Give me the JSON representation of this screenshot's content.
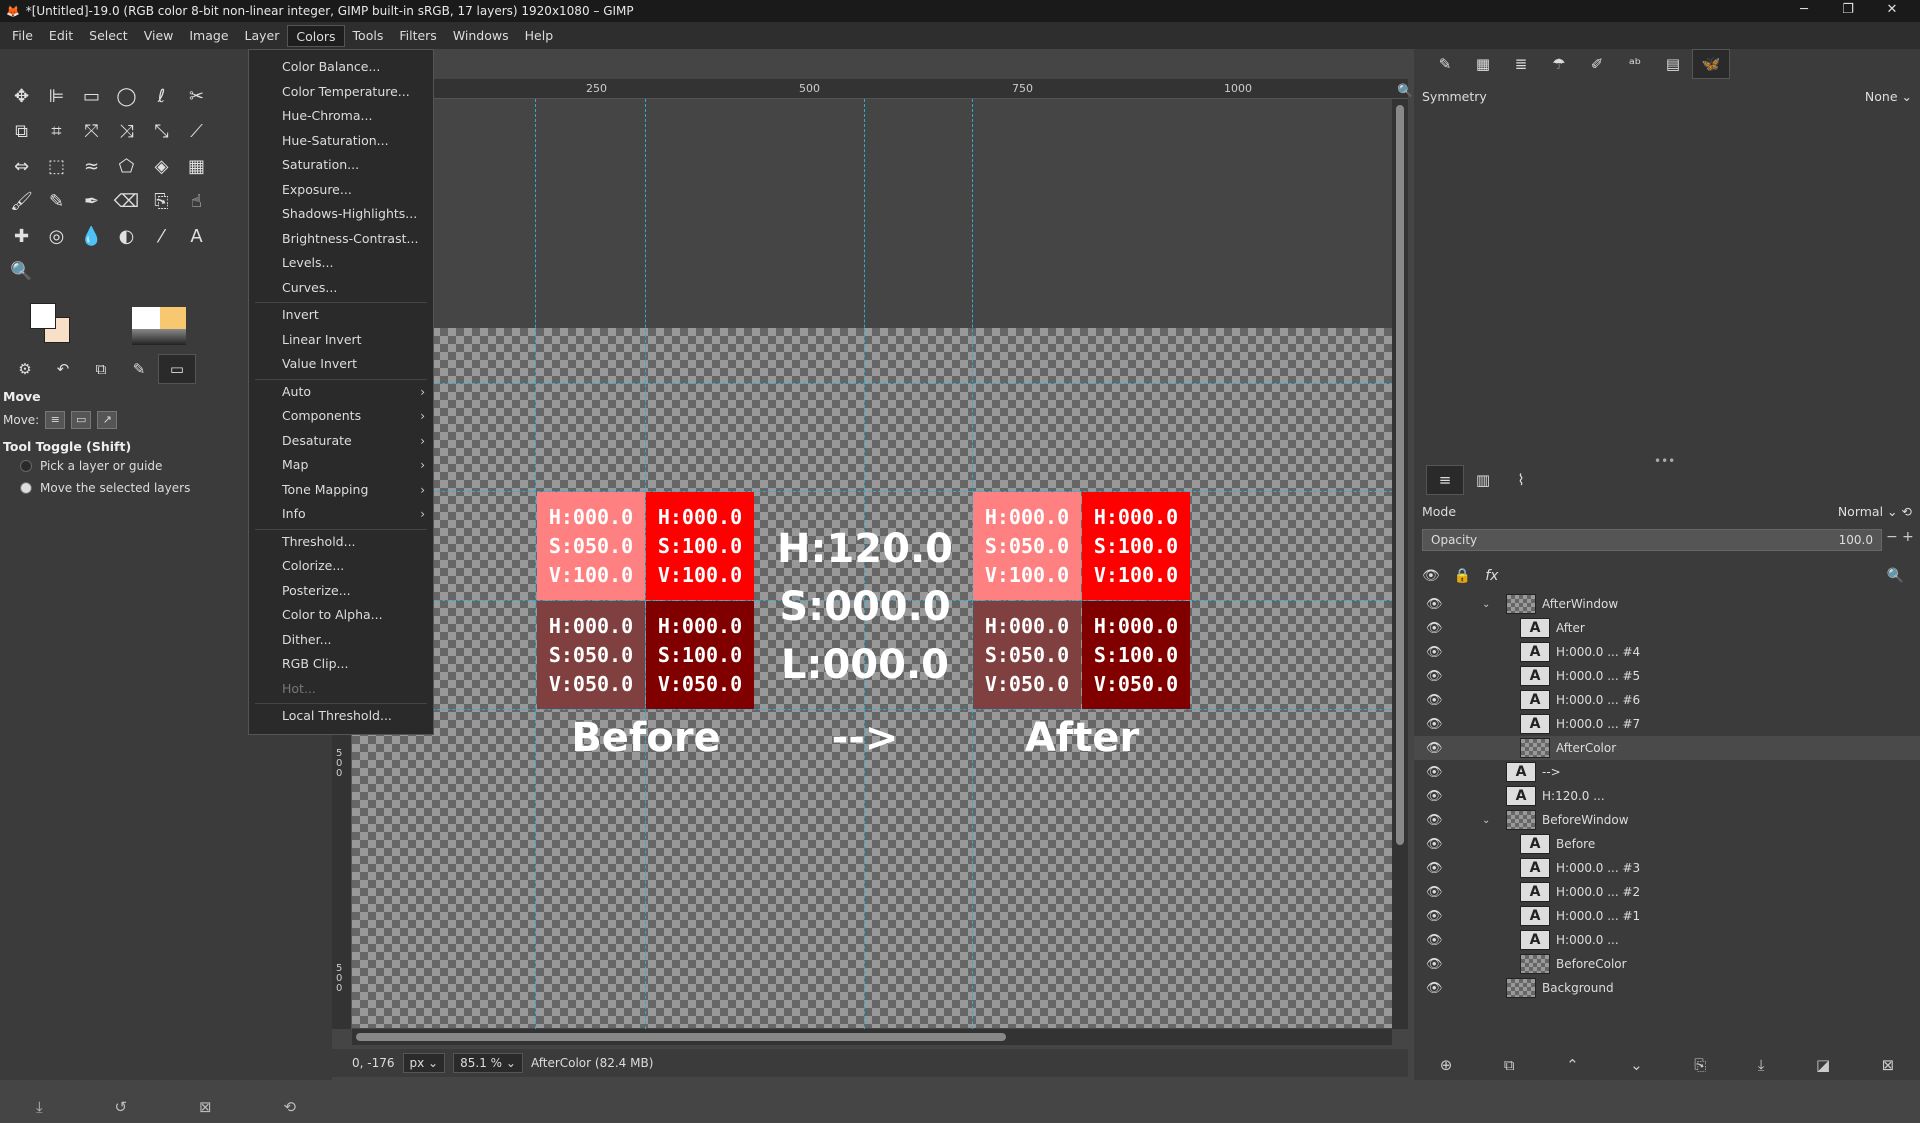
{
  "window": {
    "title": "*[Untitled]-19.0 (RGB color 8-bit non-linear integer, GIMP built-in sRGB, 17 layers) 1920x1080 – GIMP",
    "minimize": "─",
    "maximize": "❐",
    "close": "✕"
  },
  "menubar": [
    "File",
    "Edit",
    "Select",
    "View",
    "Image",
    "Layer",
    "Colors",
    "Tools",
    "Filters",
    "Windows",
    "Help"
  ],
  "colors_menu": {
    "items": [
      {
        "label": "Color Balance...",
        "submenu": false,
        "disabled": false
      },
      {
        "label": "Color Temperature...",
        "submenu": false,
        "disabled": false
      },
      {
        "label": "Hue-Chroma...",
        "submenu": false,
        "disabled": false
      },
      {
        "label": "Hue-Saturation...",
        "submenu": false,
        "disabled": false
      },
      {
        "label": "Saturation...",
        "submenu": false,
        "disabled": false
      },
      {
        "label": "Exposure...",
        "submenu": false,
        "disabled": false
      },
      {
        "label": "Shadows-Highlights...",
        "submenu": false,
        "disabled": false
      },
      {
        "label": "Brightness-Contrast...",
        "submenu": false,
        "disabled": false
      },
      {
        "label": "Levels...",
        "submenu": false,
        "disabled": false
      },
      {
        "label": "Curves...",
        "submenu": false,
        "disabled": false
      },
      {
        "label": "Invert",
        "submenu": false,
        "disabled": false
      },
      {
        "label": "Linear Invert",
        "submenu": false,
        "disabled": false
      },
      {
        "label": "Value Invert",
        "submenu": false,
        "disabled": false
      },
      {
        "label": "Auto",
        "submenu": true,
        "disabled": false
      },
      {
        "label": "Components",
        "submenu": true,
        "disabled": false
      },
      {
        "label": "Desaturate",
        "submenu": true,
        "disabled": false
      },
      {
        "label": "Map",
        "submenu": true,
        "disabled": false
      },
      {
        "label": "Tone Mapping",
        "submenu": true,
        "disabled": false
      },
      {
        "label": "Info",
        "submenu": true,
        "disabled": false
      },
      {
        "label": "Threshold...",
        "submenu": false,
        "disabled": false
      },
      {
        "label": "Colorize...",
        "submenu": false,
        "disabled": false
      },
      {
        "label": "Posterize...",
        "submenu": false,
        "disabled": false
      },
      {
        "label": "Color to Alpha...",
        "submenu": false,
        "disabled": false
      },
      {
        "label": "Dither...",
        "submenu": false,
        "disabled": false
      },
      {
        "label": "RGB Clip...",
        "submenu": false,
        "disabled": false
      },
      {
        "label": "Hot...",
        "submenu": false,
        "disabled": true
      },
      {
        "label": "Local Threshold...",
        "submenu": false,
        "disabled": false
      }
    ]
  },
  "tool_options": {
    "title": "Move",
    "move_label": "Move:",
    "toggle_title": "Tool Toggle  (Shift)",
    "option_pick": "Pick a layer or guide",
    "option_move": "Move the selected layers"
  },
  "ruler": {
    "top": [
      "250",
      "500",
      "750",
      "1000"
    ],
    "left": [
      "5\n0\n0",
      "5\n0\n0"
    ]
  },
  "canvas": {
    "swatches": [
      {
        "text": "H:000.0\nS:050.0\nV:100.0",
        "color": "#ff8080"
      },
      {
        "text": "H:000.0\nS:100.0\nV:100.0",
        "color": "#ff0000"
      },
      {
        "text": "H:000.0\nS:050.0\nV:050.0",
        "color": "#804040"
      },
      {
        "text": "H:000.0\nS:100.0\nV:050.0",
        "color": "#800000"
      }
    ],
    "center_text": "H:120.0\nS:000.0\nL:000.0",
    "before_label": "Before",
    "arrow_label": "-->",
    "after_label": "After"
  },
  "statusbar": {
    "coords": "0, -176",
    "unit": "px",
    "zoom": "85.1 %",
    "layer_info": "AfterColor (82.4 MB)"
  },
  "right_panel": {
    "symmetry_label": "Symmetry",
    "symmetry_value": "None",
    "mode_label": "Mode",
    "mode_value": "Normal",
    "opacity_label": "Opacity",
    "opacity_value": "100.0",
    "layers": [
      {
        "name": "AfterWindow",
        "depth": 0,
        "type": "group",
        "expanded": true
      },
      {
        "name": "After",
        "depth": 1,
        "type": "text"
      },
      {
        "name": "H:000.0 ... #4",
        "depth": 1,
        "type": "text"
      },
      {
        "name": "H:000.0 ... #5",
        "depth": 1,
        "type": "text"
      },
      {
        "name": "H:000.0 ... #6",
        "depth": 1,
        "type": "text"
      },
      {
        "name": "H:000.0 ... #7",
        "depth": 1,
        "type": "text"
      },
      {
        "name": "AfterColor",
        "depth": 1,
        "type": "image",
        "selected": true
      },
      {
        "name": "-->",
        "depth": 0,
        "type": "text"
      },
      {
        "name": "H:120.0 ...",
        "depth": 0,
        "type": "text"
      },
      {
        "name": "BeforeWindow",
        "depth": 0,
        "type": "group",
        "expanded": true
      },
      {
        "name": "Before",
        "depth": 1,
        "type": "text"
      },
      {
        "name": "H:000.0 ... #3",
        "depth": 1,
        "type": "text"
      },
      {
        "name": "H:000.0 ... #2",
        "depth": 1,
        "type": "text"
      },
      {
        "name": "H:000.0 ... #1",
        "depth": 1,
        "type": "text"
      },
      {
        "name": "H:000.0 ...",
        "depth": 1,
        "type": "text"
      },
      {
        "name": "BeforeColor",
        "depth": 1,
        "type": "image"
      },
      {
        "name": "Background",
        "depth": 0,
        "type": "image"
      }
    ]
  }
}
